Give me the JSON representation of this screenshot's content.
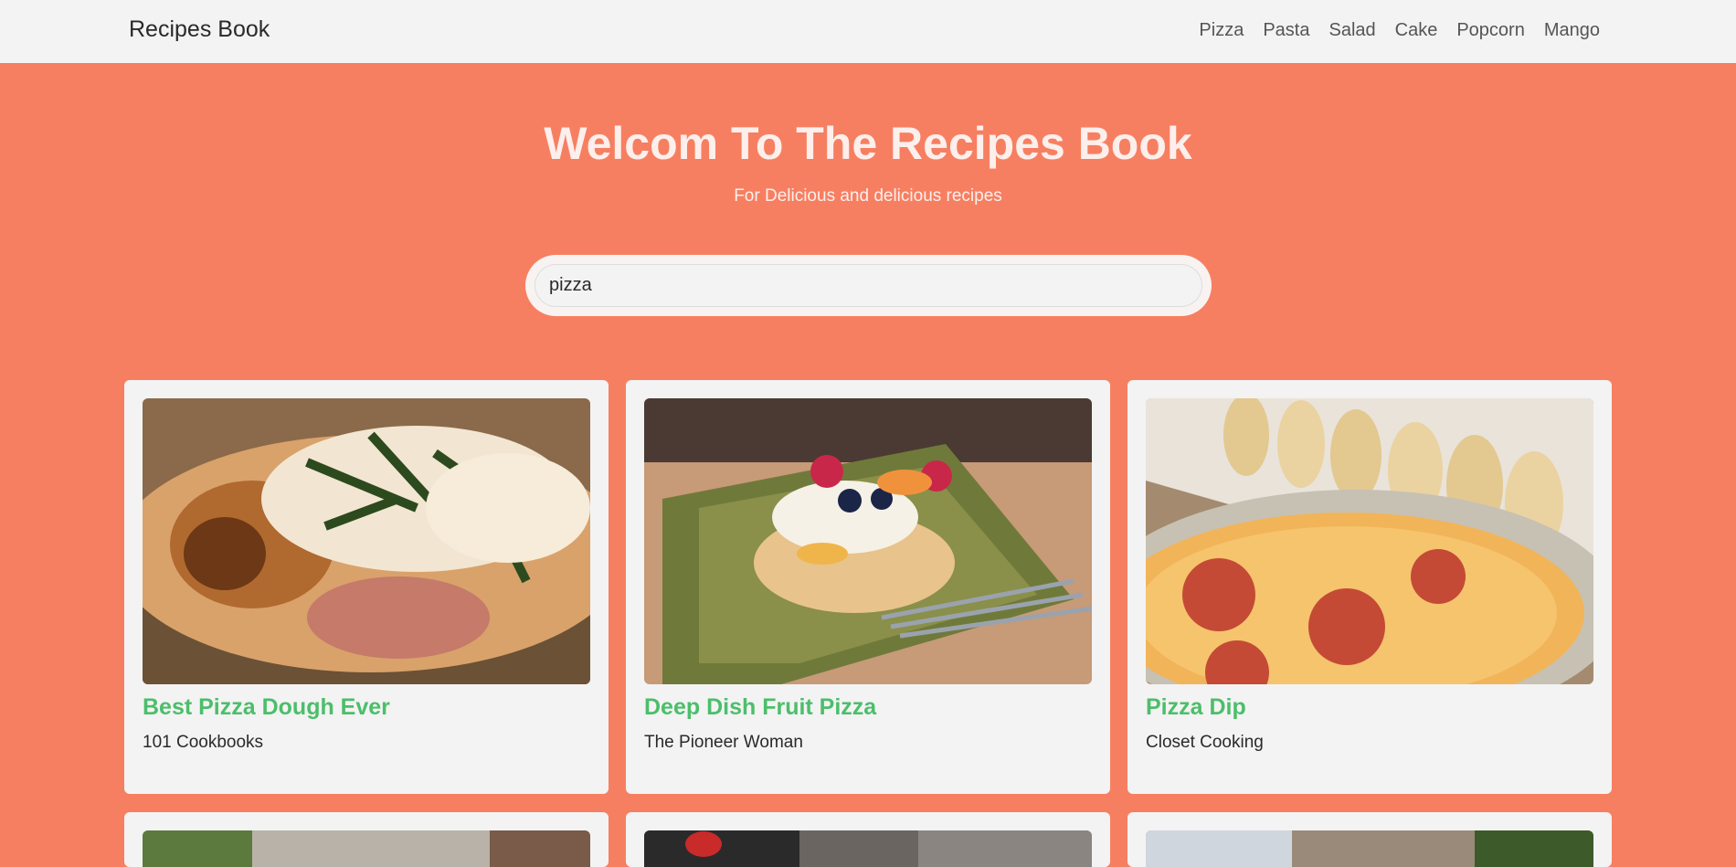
{
  "navbar": {
    "brand": "Recipes Book",
    "links": [
      "Pizza",
      "Pasta",
      "Salad",
      "Cake",
      "Popcorn",
      "Mango"
    ]
  },
  "hero": {
    "title": "Welcom To The Recipes Book",
    "subtitle": "For Delicious and delicious recipes"
  },
  "search": {
    "value": "pizza"
  },
  "recipes": [
    {
      "title": "Best Pizza Dough Ever",
      "source": "101 Cookbooks"
    },
    {
      "title": "Deep Dish Fruit Pizza",
      "source": "The Pioneer Woman"
    },
    {
      "title": "Pizza Dip",
      "source": "Closet Cooking"
    }
  ],
  "colors": {
    "background": "#f77f61",
    "navbar": "#f3f3f3",
    "recipe_title": "#4cbe6b",
    "hero_text": "#fcefec"
  }
}
